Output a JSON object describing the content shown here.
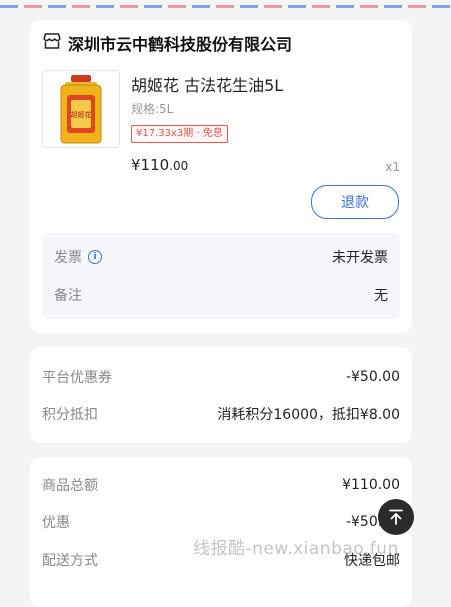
{
  "shop": {
    "name": "深圳市云中鹤科技股份有限公司",
    "icon": "store-icon"
  },
  "product": {
    "title": "胡姬花 古法花生油5L",
    "spec": "规格:5L",
    "installment_tag": "¥17.33x3期 · 免息",
    "price_int": "¥110",
    "price_dec": ".00",
    "quantity": "x1",
    "refund_label": "退款",
    "image_label": "胡姬花"
  },
  "invoice": {
    "label": "发票",
    "value": "未开发票"
  },
  "remark": {
    "label": "备注",
    "value": "无"
  },
  "discounts": {
    "coupon_label": "平台优惠券",
    "coupon_value": "-¥50.00",
    "points_label": "积分抵扣",
    "points_value": "消耗积分16000，抵扣¥8.00"
  },
  "summary": {
    "total_label": "商品总额",
    "total_value": "¥110.00",
    "discount_label": "优惠",
    "discount_value": "-¥50.00",
    "shipping_label": "配送方式",
    "shipping_value": "快递包邮"
  },
  "watermark": "线报酷-new.xianbao.fun",
  "colors": {
    "accent": "#3a73d6",
    "tag_red": "#e45a4a"
  }
}
